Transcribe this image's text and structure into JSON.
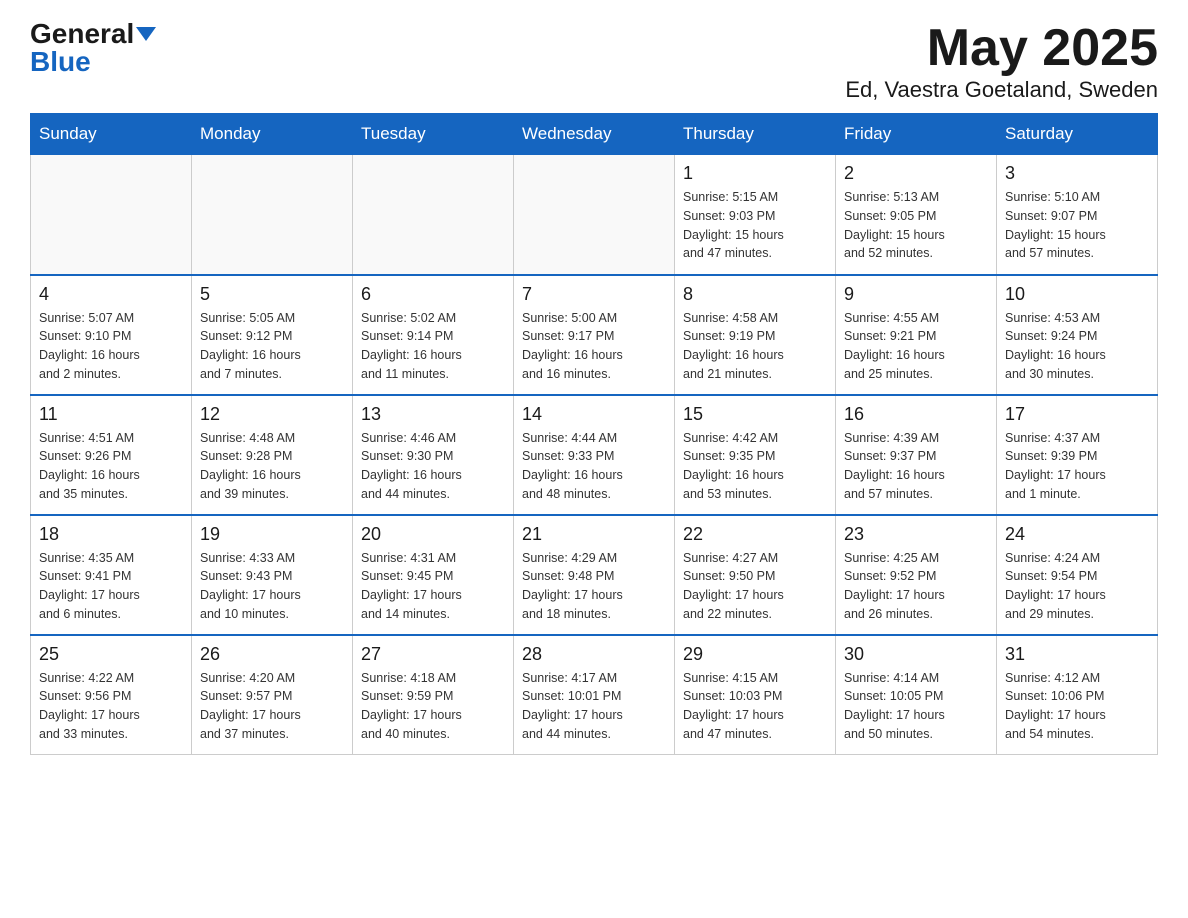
{
  "header": {
    "logo_general": "General",
    "logo_blue": "Blue",
    "month_title": "May 2025",
    "location": "Ed, Vaestra Goetaland, Sweden"
  },
  "weekdays": [
    "Sunday",
    "Monday",
    "Tuesday",
    "Wednesday",
    "Thursday",
    "Friday",
    "Saturday"
  ],
  "weeks": [
    [
      {
        "day": "",
        "info": ""
      },
      {
        "day": "",
        "info": ""
      },
      {
        "day": "",
        "info": ""
      },
      {
        "day": "",
        "info": ""
      },
      {
        "day": "1",
        "info": "Sunrise: 5:15 AM\nSunset: 9:03 PM\nDaylight: 15 hours\nand 47 minutes."
      },
      {
        "day": "2",
        "info": "Sunrise: 5:13 AM\nSunset: 9:05 PM\nDaylight: 15 hours\nand 52 minutes."
      },
      {
        "day": "3",
        "info": "Sunrise: 5:10 AM\nSunset: 9:07 PM\nDaylight: 15 hours\nand 57 minutes."
      }
    ],
    [
      {
        "day": "4",
        "info": "Sunrise: 5:07 AM\nSunset: 9:10 PM\nDaylight: 16 hours\nand 2 minutes."
      },
      {
        "day": "5",
        "info": "Sunrise: 5:05 AM\nSunset: 9:12 PM\nDaylight: 16 hours\nand 7 minutes."
      },
      {
        "day": "6",
        "info": "Sunrise: 5:02 AM\nSunset: 9:14 PM\nDaylight: 16 hours\nand 11 minutes."
      },
      {
        "day": "7",
        "info": "Sunrise: 5:00 AM\nSunset: 9:17 PM\nDaylight: 16 hours\nand 16 minutes."
      },
      {
        "day": "8",
        "info": "Sunrise: 4:58 AM\nSunset: 9:19 PM\nDaylight: 16 hours\nand 21 minutes."
      },
      {
        "day": "9",
        "info": "Sunrise: 4:55 AM\nSunset: 9:21 PM\nDaylight: 16 hours\nand 25 minutes."
      },
      {
        "day": "10",
        "info": "Sunrise: 4:53 AM\nSunset: 9:24 PM\nDaylight: 16 hours\nand 30 minutes."
      }
    ],
    [
      {
        "day": "11",
        "info": "Sunrise: 4:51 AM\nSunset: 9:26 PM\nDaylight: 16 hours\nand 35 minutes."
      },
      {
        "day": "12",
        "info": "Sunrise: 4:48 AM\nSunset: 9:28 PM\nDaylight: 16 hours\nand 39 minutes."
      },
      {
        "day": "13",
        "info": "Sunrise: 4:46 AM\nSunset: 9:30 PM\nDaylight: 16 hours\nand 44 minutes."
      },
      {
        "day": "14",
        "info": "Sunrise: 4:44 AM\nSunset: 9:33 PM\nDaylight: 16 hours\nand 48 minutes."
      },
      {
        "day": "15",
        "info": "Sunrise: 4:42 AM\nSunset: 9:35 PM\nDaylight: 16 hours\nand 53 minutes."
      },
      {
        "day": "16",
        "info": "Sunrise: 4:39 AM\nSunset: 9:37 PM\nDaylight: 16 hours\nand 57 minutes."
      },
      {
        "day": "17",
        "info": "Sunrise: 4:37 AM\nSunset: 9:39 PM\nDaylight: 17 hours\nand 1 minute."
      }
    ],
    [
      {
        "day": "18",
        "info": "Sunrise: 4:35 AM\nSunset: 9:41 PM\nDaylight: 17 hours\nand 6 minutes."
      },
      {
        "day": "19",
        "info": "Sunrise: 4:33 AM\nSunset: 9:43 PM\nDaylight: 17 hours\nand 10 minutes."
      },
      {
        "day": "20",
        "info": "Sunrise: 4:31 AM\nSunset: 9:45 PM\nDaylight: 17 hours\nand 14 minutes."
      },
      {
        "day": "21",
        "info": "Sunrise: 4:29 AM\nSunset: 9:48 PM\nDaylight: 17 hours\nand 18 minutes."
      },
      {
        "day": "22",
        "info": "Sunrise: 4:27 AM\nSunset: 9:50 PM\nDaylight: 17 hours\nand 22 minutes."
      },
      {
        "day": "23",
        "info": "Sunrise: 4:25 AM\nSunset: 9:52 PM\nDaylight: 17 hours\nand 26 minutes."
      },
      {
        "day": "24",
        "info": "Sunrise: 4:24 AM\nSunset: 9:54 PM\nDaylight: 17 hours\nand 29 minutes."
      }
    ],
    [
      {
        "day": "25",
        "info": "Sunrise: 4:22 AM\nSunset: 9:56 PM\nDaylight: 17 hours\nand 33 minutes."
      },
      {
        "day": "26",
        "info": "Sunrise: 4:20 AM\nSunset: 9:57 PM\nDaylight: 17 hours\nand 37 minutes."
      },
      {
        "day": "27",
        "info": "Sunrise: 4:18 AM\nSunset: 9:59 PM\nDaylight: 17 hours\nand 40 minutes."
      },
      {
        "day": "28",
        "info": "Sunrise: 4:17 AM\nSunset: 10:01 PM\nDaylight: 17 hours\nand 44 minutes."
      },
      {
        "day": "29",
        "info": "Sunrise: 4:15 AM\nSunset: 10:03 PM\nDaylight: 17 hours\nand 47 minutes."
      },
      {
        "day": "30",
        "info": "Sunrise: 4:14 AM\nSunset: 10:05 PM\nDaylight: 17 hours\nand 50 minutes."
      },
      {
        "day": "31",
        "info": "Sunrise: 4:12 AM\nSunset: 10:06 PM\nDaylight: 17 hours\nand 54 minutes."
      }
    ]
  ]
}
